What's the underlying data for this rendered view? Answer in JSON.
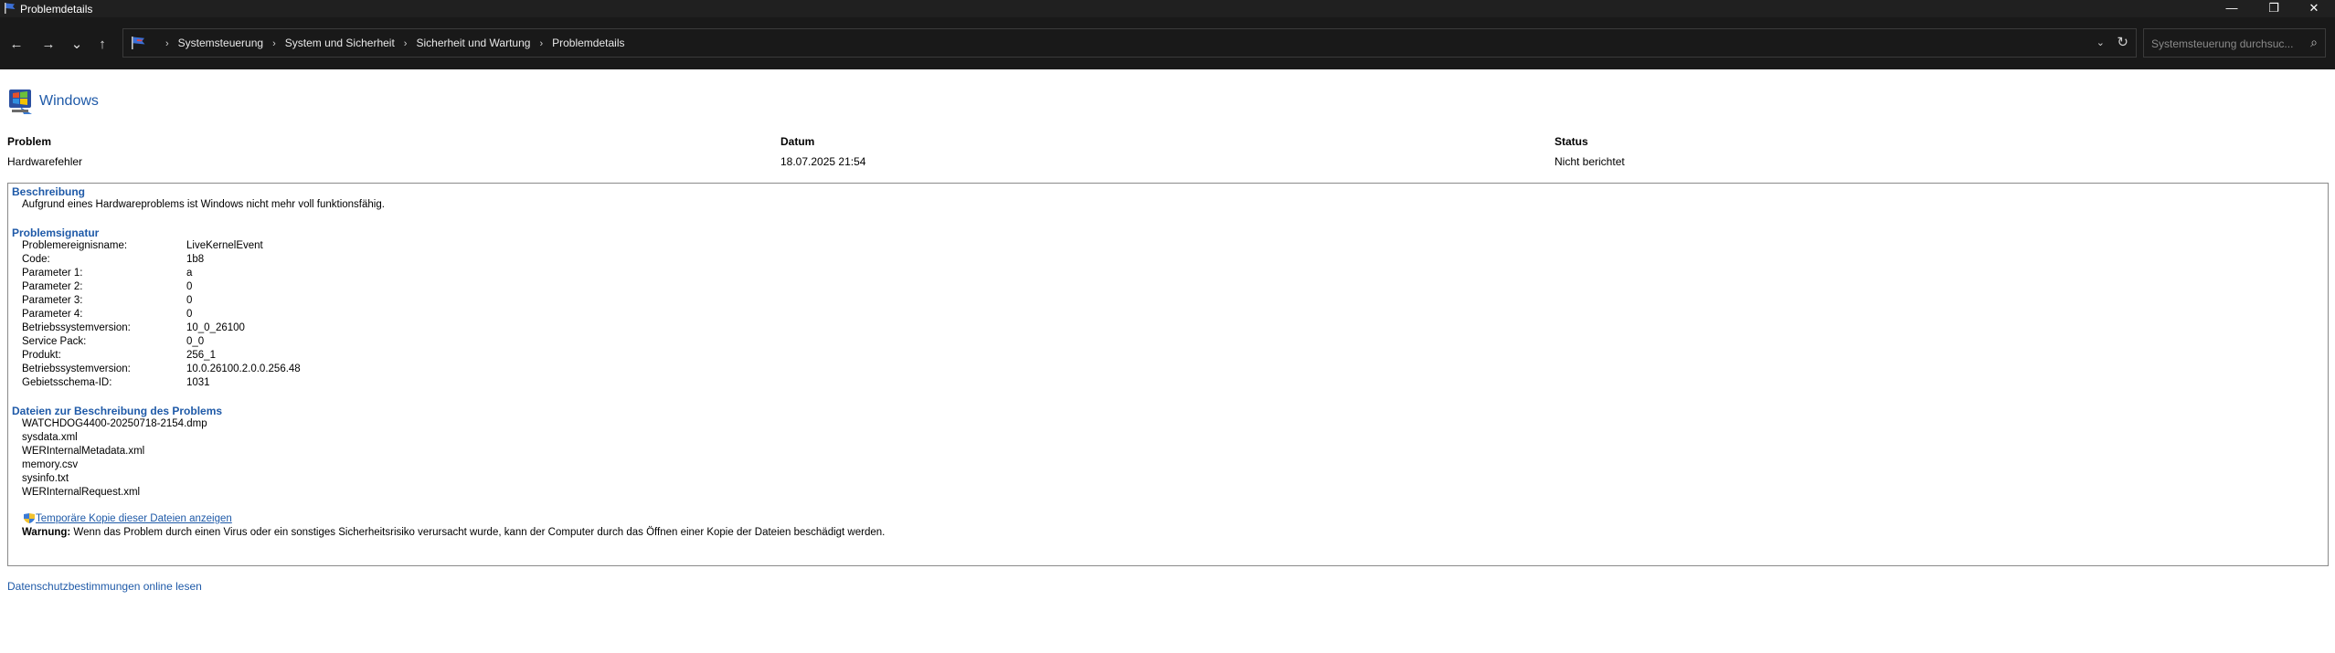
{
  "window": {
    "title": "Problemdetails",
    "minimize": "—",
    "maximize": "❐",
    "close": "✕"
  },
  "nav": {
    "back": "←",
    "forward": "→",
    "recent": "⌄",
    "up": "↑",
    "breadcrumbs": [
      "Systemsteuerung",
      "System und Sicherheit",
      "Sicherheit und Wartung",
      "Problemdetails"
    ],
    "search_placeholder": "Systemsteuerung durchsuc..."
  },
  "header": {
    "brand": "Windows"
  },
  "columns": {
    "problem_label": "Problem",
    "problem_value": "Hardwarefehler",
    "date_label": "Datum",
    "date_value": "18.07.2025 21:54",
    "status_label": "Status",
    "status_value": "Nicht berichtet"
  },
  "description": {
    "title": "Beschreibung",
    "text": "Aufgrund eines Hardwareproblems ist Windows nicht mehr voll funktionsfähig."
  },
  "signature": {
    "title": "Problemsignatur",
    "rows": [
      {
        "key": "Problemereignisname:",
        "value": "LiveKernelEvent"
      },
      {
        "key": "Code:",
        "value": "1b8"
      },
      {
        "key": "Parameter 1:",
        "value": "a"
      },
      {
        "key": "Parameter 2:",
        "value": "0"
      },
      {
        "key": "Parameter 3:",
        "value": "0"
      },
      {
        "key": "Parameter 4:",
        "value": "0"
      },
      {
        "key": "Betriebssystemversion:",
        "value": "10_0_26100"
      },
      {
        "key": "Service Pack:",
        "value": "0_0"
      },
      {
        "key": "Produkt:",
        "value": "256_1"
      },
      {
        "key": "Betriebssystemversion:",
        "value": "10.0.26100.2.0.0.256.48"
      },
      {
        "key": "Gebietsschema-ID:",
        "value": "1031"
      }
    ]
  },
  "files": {
    "title": "Dateien zur Beschreibung des Problems",
    "items": [
      "WATCHDOG4400-20250718-2154.dmp",
      "sysdata.xml",
      "WERInternalMetadata.xml",
      "memory.csv",
      "sysinfo.txt",
      "WERInternalRequest.xml"
    ],
    "temp_copy_link": "Temporäre Kopie dieser Dateien anzeigen",
    "warning_label": "Warnung:",
    "warning_text": " Wenn das Problem durch einen Virus oder ein sonstiges Sicherheitsrisiko verursacht wurde, kann der Computer durch das Öffnen einer Kopie der Dateien beschädigt werden."
  },
  "footer": {
    "privacy_link": "Datenschutzbestimmungen online lesen"
  }
}
